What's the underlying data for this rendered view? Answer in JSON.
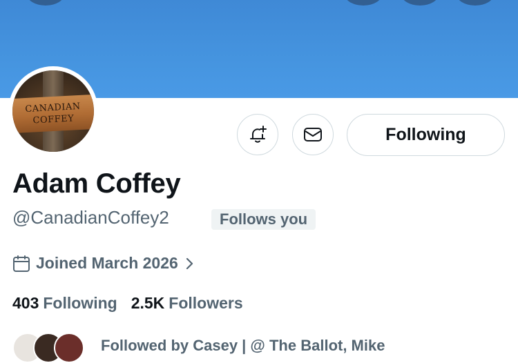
{
  "colors": {
    "banner": "#4594df",
    "primary_text": "#0f1419",
    "secondary_text": "#536471",
    "border": "#cfd9de",
    "badge_bg": "#eff3f4"
  },
  "avatar": {
    "sign_line1": "CANADIAN",
    "sign_line2": "COFFEY"
  },
  "actions": {
    "notify_icon": "bell-plus-icon",
    "message_icon": "envelope-icon",
    "follow_label": "Following"
  },
  "profile": {
    "display_name": "Adam Coffey",
    "handle": "@CanadianCoffey2",
    "follows_you": "Follows you",
    "joined": "Joined March 2026"
  },
  "stats": {
    "following_count": "403",
    "following_label": "Following",
    "followers_count": "2.5K",
    "followers_label": "Followers"
  },
  "followed_by": {
    "text": "Followed by Casey | @ The Ballot, Mike"
  }
}
